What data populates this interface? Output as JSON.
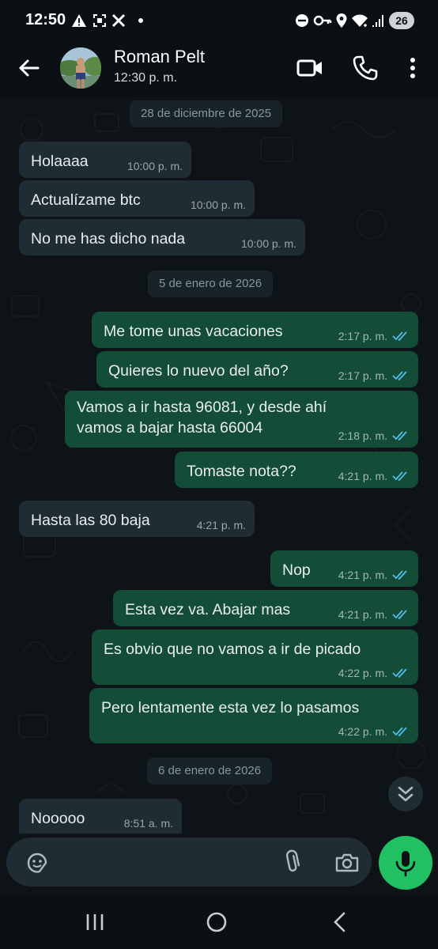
{
  "status_bar": {
    "time": "12:50",
    "battery": "26",
    "icons": [
      "alert-icon",
      "screenshot-icon",
      "x-app-icon",
      "dot-icon",
      "dnd-icon",
      "key-icon",
      "location-icon",
      "wifi-icon",
      "signal-icon"
    ]
  },
  "header": {
    "contact_name": "Roman Pelt",
    "contact_status": "12:30 p. m.",
    "icons": [
      "back-arrow-icon",
      "video-call-icon",
      "phone-icon",
      "more-vertical-icon"
    ]
  },
  "chat": {
    "dates": [
      "28 de diciembre de 2025",
      "5 de enero de 2026",
      "6 de enero de 2026"
    ],
    "messages": [
      {
        "dir": "in",
        "text": "Holaaaa",
        "time": "10:00 p. m."
      },
      {
        "dir": "in",
        "text": "Actualízame btc",
        "time": "10:00 p. m."
      },
      {
        "dir": "in",
        "text": "No me has dicho nada",
        "time": "10:00 p. m."
      },
      {
        "dir": "out",
        "text": "Me tome unas vacaciones",
        "time": "2:17 p. m.",
        "read": true
      },
      {
        "dir": "out",
        "text": "Quieres lo nuevo del año?",
        "time": "2:17 p. m.",
        "read": true
      },
      {
        "dir": "out",
        "text": "Vamos a ir hasta 96081, y desde ahí\nvamos a bajar hasta 66004",
        "time": "2:18 p. m.",
        "read": true
      },
      {
        "dir": "out",
        "text": "Tomaste nota??",
        "time": "4:21 p. m.",
        "read": true
      },
      {
        "dir": "in",
        "text": "Hasta las 80 baja",
        "time": "4:21 p. m."
      },
      {
        "dir": "out",
        "text": "Nop",
        "time": "4:21 p. m.",
        "read": true
      },
      {
        "dir": "out",
        "text": "Esta vez va. Abajar mas",
        "time": "4:21 p. m.",
        "read": true
      },
      {
        "dir": "out",
        "text": "Es obvio que no vamos a ir de picado",
        "time": "4:22 p. m.",
        "read": true
      },
      {
        "dir": "out",
        "text": "Pero lentamente esta vez lo pasamos",
        "time": "4:22 p. m.",
        "read": true
      },
      {
        "dir": "in",
        "text": "Nooooo",
        "time": "8:51 a. m."
      }
    ]
  },
  "input": {
    "placeholder": "",
    "icons": [
      "sticker-icon",
      "paperclip-icon",
      "camera-icon",
      "microphone-icon"
    ]
  },
  "nav_bar": {
    "icons": [
      "recents-icon",
      "home-icon",
      "back-icon"
    ]
  },
  "colors": {
    "background": "#0b1014",
    "incoming_bubble": "#1f2c34",
    "outgoing_bubble": "#134d37",
    "read_ticks": "#53bdeb",
    "mic_button": "#21c063"
  }
}
